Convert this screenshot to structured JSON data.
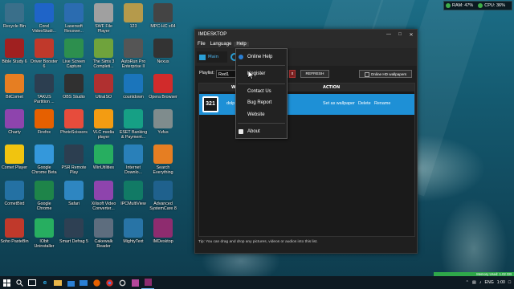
{
  "status_widget": {
    "ram": "RAM: 47%",
    "cpu": "CPU: 36%"
  },
  "desktop_icons": [
    {
      "label": "Recycle Bin",
      "color": "#3a6f8a"
    },
    {
      "label": "Corel VideoStudi...",
      "color": "#1f64c8"
    },
    {
      "label": "Lasersoft Recover...",
      "color": "#2b6cb0"
    },
    {
      "label": "SWF File Player",
      "color": "#a0a0a0"
    },
    {
      "label": "123",
      "color": "#b59a4b"
    },
    {
      "label": "MPC-HC x64",
      "color": "#444"
    },
    {
      "label": "Bible Study 6",
      "color": "#a02020"
    },
    {
      "label": "Driver Booster 6",
      "color": "#c0392b"
    },
    {
      "label": "Live Screen Capture",
      "color": "#2d8f4e"
    },
    {
      "label": "The Sims 3 Completi...",
      "color": "#6fa33c"
    },
    {
      "label": "AutoRun Pro Enterprise II",
      "color": "#555"
    },
    {
      "label": "Nexus",
      "color": "#333"
    },
    {
      "label": "BitComet",
      "color": "#e67e22"
    },
    {
      "label": "TAKUS Partition ...",
      "color": "#2c3e50"
    },
    {
      "label": "OBS Studio",
      "color": "#303030"
    },
    {
      "label": "UltraISO",
      "color": "#b03030"
    },
    {
      "label": "countdown",
      "color": "#1b75bb"
    },
    {
      "label": "Opera Browser",
      "color": "#d12b2b"
    },
    {
      "label": "Charty",
      "color": "#8e44ad"
    },
    {
      "label": "Firefox",
      "color": "#e66000"
    },
    {
      "label": "PhotoScissors",
      "color": "#e74c3c"
    },
    {
      "label": "VLC media player",
      "color": "#f39c12"
    },
    {
      "label": "ESET Banking & Payment...",
      "color": "#16a085"
    },
    {
      "label": "Yufus",
      "color": "#7f8c8d"
    },
    {
      "label": "Comet Player",
      "color": "#f1c40f"
    },
    {
      "label": "Google Chrome Beta",
      "color": "#3498db"
    },
    {
      "label": "PSR Remote Play",
      "color": "#2c3e50"
    },
    {
      "label": "WinUtilities",
      "color": "#27ae60"
    },
    {
      "label": "Internet Downlo...",
      "color": "#2980b9"
    },
    {
      "label": "Search Everything",
      "color": "#e67e22"
    },
    {
      "label": "CometBird",
      "color": "#2471a3"
    },
    {
      "label": "Google Chrome",
      "color": "#1e8449"
    },
    {
      "label": "Safari",
      "color": "#2e86c1"
    },
    {
      "label": "Xilisoft Video Converter...",
      "color": "#8e44ad"
    },
    {
      "label": "IPCMultiView",
      "color": "#117a65"
    },
    {
      "label": "Advanced SystemCare 8",
      "color": "#1f618d"
    },
    {
      "label": "Soho PasteBin",
      "color": "#c0392b"
    },
    {
      "label": "IObit Uninstaller",
      "color": "#27ae60"
    },
    {
      "label": "Smart Defrag 5",
      "color": "#2e4053"
    },
    {
      "label": "Cakewalk Reader",
      "color": "#5d6d7e"
    },
    {
      "label": "MightyText",
      "color": "#2874a6"
    },
    {
      "label": "IMDesktop",
      "color": "#8e2c6f"
    }
  ],
  "window": {
    "title": "IMDESKTOP",
    "menu": {
      "file": "File",
      "language": "Language",
      "help": "Help"
    },
    "tab_main": "Main",
    "playlist_label": "Playlist:",
    "playlist_value": "Red1",
    "delete_label": "x",
    "refresh_label": "REFRESH",
    "hd_label": "Online HD wallpapers",
    "col_wa": "WA",
    "col_action": "ACTION",
    "row": {
      "name": "dolp",
      "set_wallpaper": "Set as wallpaper",
      "delete": "Delete",
      "rename": "Rename"
    },
    "tip": "Tip: You can drag and drop any pictures, videos or audios into this list."
  },
  "help_menu": {
    "online_help": "Online Help",
    "register": "Register",
    "contact_us": "Contact Us",
    "bug_report": "Bug Report",
    "website": "Website",
    "about": "About"
  },
  "taskbar": {
    "memory": "Memory Used: 1.02 GB",
    "lang": "ENG",
    "time": "1:00"
  }
}
